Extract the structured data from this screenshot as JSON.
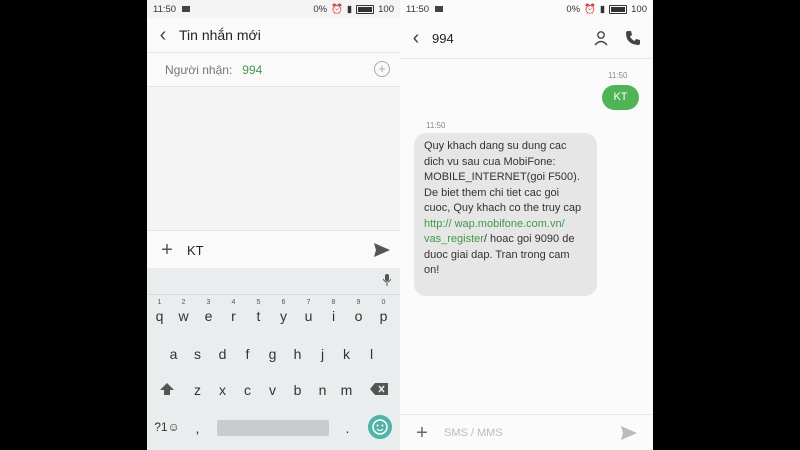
{
  "left": {
    "status": {
      "time": "11:50",
      "network": "0%",
      "battery": "100"
    },
    "title": "Tin nhắn mới",
    "recipient_label": "Người nhận:",
    "recipient_value": "994",
    "compose_text": "KT",
    "keyboard": {
      "row1": [
        "q",
        "w",
        "e",
        "r",
        "t",
        "y",
        "u",
        "i",
        "o",
        "p"
      ],
      "row1_numbers": [
        "1",
        "2",
        "3",
        "4",
        "5",
        "6",
        "7",
        "8",
        "9",
        "0"
      ],
      "row2": [
        "a",
        "s",
        "d",
        "f",
        "g",
        "h",
        "j",
        "k",
        "l"
      ],
      "row3": [
        "z",
        "x",
        "c",
        "v",
        "b",
        "n",
        "m"
      ],
      "bottom": {
        "symbols": "?1☺",
        "comma": ",",
        "period": "."
      }
    }
  },
  "right": {
    "status": {
      "time": "11:50",
      "network": "0%",
      "battery": "100"
    },
    "contact": "994",
    "messages": [
      {
        "time": "11:50",
        "direction": "out",
        "text": "KT"
      },
      {
        "time": "11:50",
        "direction": "in",
        "text_before": "Quy khach dang su dung cac dich vu sau cua MobiFone: MOBILE_INTERNET(goi F500). De biet them chi tiet cac goi cuoc, Quy khach co the truy cap ",
        "link1": "http:// wap.mobifone.com.vn/ vas_register",
        "text_after": "/ hoac goi 9090 de duoc giai dap. Tran trong cam on!"
      }
    ],
    "compose_placeholder": "SMS / MMS"
  },
  "colors": {
    "accent_green": "#4eb455",
    "link_green": "#3f9a4a"
  }
}
